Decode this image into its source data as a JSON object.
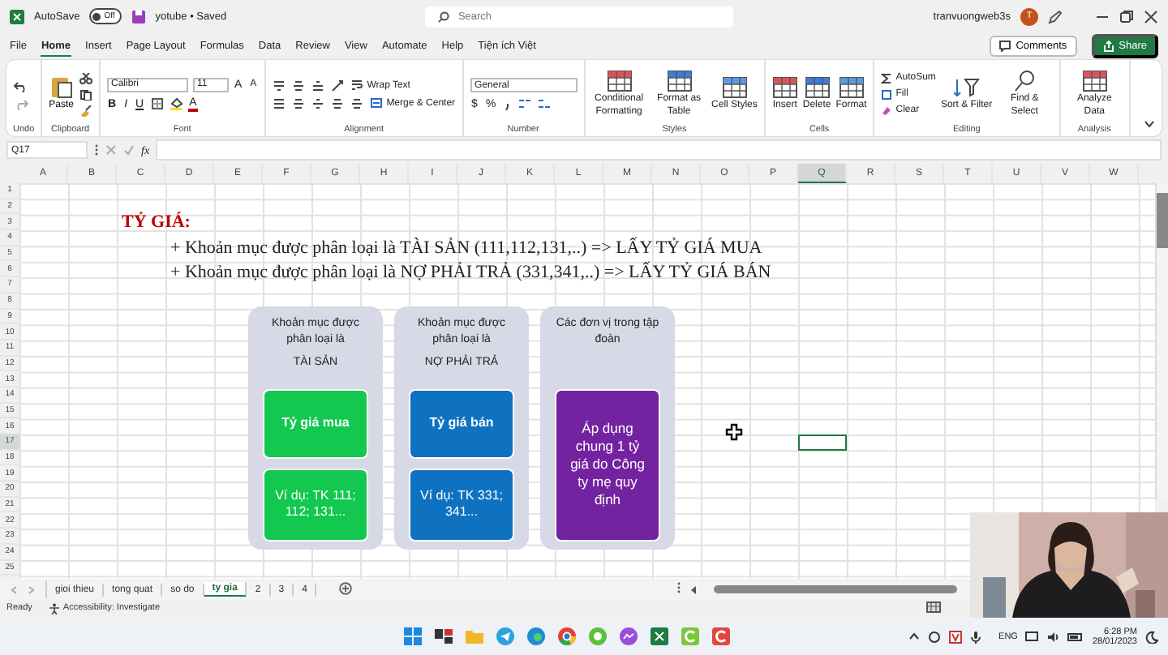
{
  "title_bar": {
    "autosave_label": "AutoSave",
    "autosave_toggle": {
      "label": "Off",
      "on": false
    },
    "file_name": "yotube • Saved",
    "search": {
      "placeholder": "Search"
    },
    "user_name": "tranvuongweb3s",
    "avatar_initial": "T"
  },
  "ribbon_tabs": [
    {
      "label": "File",
      "selected": false
    },
    {
      "label": "Home",
      "selected": true
    },
    {
      "label": "Insert",
      "selected": false
    },
    {
      "label": "Page Layout",
      "selected": false
    },
    {
      "label": "Formulas",
      "selected": false
    },
    {
      "label": "Data",
      "selected": false
    },
    {
      "label": "Review",
      "selected": false
    },
    {
      "label": "View",
      "selected": false
    },
    {
      "label": "Automate",
      "selected": false
    },
    {
      "label": "Help",
      "selected": false
    },
    {
      "label": "Tiện ích Việt",
      "selected": false
    }
  ],
  "comments_button": "Comments",
  "share_button": "Share",
  "ribbon_groups": [
    {
      "kind": "undo",
      "label": "Undo"
    },
    {
      "kind": "clipboard",
      "label": "Clipboard",
      "paste": "Paste"
    },
    {
      "kind": "font",
      "label": "Font",
      "font_name": "Calibri",
      "font_size": "11",
      "grow": "A",
      "shrink": "A",
      "bold": "B",
      "italic": "I",
      "underline": "U",
      "font_color": "A"
    },
    {
      "kind": "alignment",
      "label": "Alignment",
      "wrap_text": "Wrap Text",
      "merge": "Merge & Center"
    },
    {
      "kind": "number",
      "label": "Number",
      "format": "General",
      "currency": "$",
      "percent": "%"
    },
    {
      "kind": "large_buttons",
      "label": "Styles",
      "buttons": [
        "Conditional Formatting",
        "Format as Table",
        "Cell Styles"
      ]
    },
    {
      "kind": "large_buttons",
      "label": "Cells",
      "buttons": [
        "Insert",
        "Delete",
        "Format"
      ]
    },
    {
      "kind": "editing",
      "label": "Editing",
      "autosum": "AutoSum",
      "fill": "Fill",
      "clear": "Clear",
      "sort": "Sort & Filter",
      "find": "Find & Select"
    },
    {
      "kind": "large_buttons",
      "label": "Analysis",
      "buttons": [
        "Analyze Data"
      ]
    }
  ],
  "formula_bar": {
    "name_box": "Q17",
    "fx": "fx"
  },
  "columns": [
    {
      "label": "A",
      "selected": false
    },
    {
      "label": "B",
      "selected": false
    },
    {
      "label": "C",
      "selected": false
    },
    {
      "label": "D",
      "selected": false
    },
    {
      "label": "E",
      "selected": false
    },
    {
      "label": "F",
      "selected": false
    },
    {
      "label": "G",
      "selected": false
    },
    {
      "label": "H",
      "selected": false
    },
    {
      "label": "I",
      "selected": false
    },
    {
      "label": "J",
      "selected": false
    },
    {
      "label": "K",
      "selected": false
    },
    {
      "label": "L",
      "selected": false
    },
    {
      "label": "M",
      "selected": false
    },
    {
      "label": "N",
      "selected": false
    },
    {
      "label": "O",
      "selected": false
    },
    {
      "label": "P",
      "selected": false
    },
    {
      "label": "Q",
      "selected": true
    },
    {
      "label": "R",
      "selected": false
    },
    {
      "label": "S",
      "selected": false
    },
    {
      "label": "T",
      "selected": false
    },
    {
      "label": "U",
      "selected": false
    },
    {
      "label": "V",
      "selected": false
    },
    {
      "label": "W",
      "selected": false
    }
  ],
  "rows": [
    {
      "label": "1",
      "selected": false
    },
    {
      "label": "2",
      "selected": false
    },
    {
      "label": "3",
      "selected": false
    },
    {
      "label": "4",
      "selected": false
    },
    {
      "label": "5",
      "selected": false
    },
    {
      "label": "6",
      "selected": false
    },
    {
      "label": "7",
      "selected": false
    },
    {
      "label": "8",
      "selected": false
    },
    {
      "label": "9",
      "selected": false
    },
    {
      "label": "10",
      "selected": false
    },
    {
      "label": "11",
      "selected": false
    },
    {
      "label": "12",
      "selected": false
    },
    {
      "label": "13",
      "selected": false
    },
    {
      "label": "14",
      "selected": false
    },
    {
      "label": "15",
      "selected": false
    },
    {
      "label": "16",
      "selected": false
    },
    {
      "label": "17",
      "selected": true
    },
    {
      "label": "18",
      "selected": false
    },
    {
      "label": "19",
      "selected": false
    },
    {
      "label": "20",
      "selected": false
    },
    {
      "label": "21",
      "selected": false
    },
    {
      "label": "22",
      "selected": false
    },
    {
      "label": "23",
      "selected": false
    },
    {
      "label": "24",
      "selected": false
    },
    {
      "label": "25",
      "selected": false
    }
  ],
  "sheet_content": {
    "heading": "TỶ GIÁ:",
    "lines": [
      "+ Khoản mục được phân loại là TÀI SẢN (111,112,131,..) => LẤY TỶ GIÁ MUA",
      "+ Khoản mục được phân loại là NỢ PHẢI TRẢ (331,341,..) => LẤY TỶ GIÁ BÁN"
    ],
    "cards": [
      {
        "title": "Khoản mục được phân loại là",
        "subtitle": "TÀI SẢN",
        "boxes": [
          {
            "kind": "label",
            "text": "Tỷ giá mua",
            "color": "#12c84e"
          },
          {
            "kind": "note",
            "text": "Ví dụ: TK 111; 112; 131...",
            "color": "#12c84e"
          }
        ]
      },
      {
        "title": "Khoản mục được phân loại là",
        "subtitle": "NỢ PHẢI TRẢ",
        "boxes": [
          {
            "kind": "label",
            "text": "Tỷ giá bán",
            "color": "#0f72c0"
          },
          {
            "kind": "note",
            "text": "Ví dụ: TK 331; 341...",
            "color": "#0f72c0"
          }
        ]
      },
      {
        "title": "Các đơn vị trong tập đoàn",
        "boxes": [
          {
            "kind": "tall",
            "text": "Áp dụng chung 1 tỷ giá do Công ty mẹ quy định",
            "color": "#7322a0"
          }
        ]
      }
    ]
  },
  "sheet_tabs": [
    {
      "label": "gioi thieu",
      "selected": false
    },
    {
      "label": "tong quat",
      "selected": false
    },
    {
      "label": "so do",
      "selected": false
    },
    {
      "label": "ty gia",
      "selected": true
    },
    {
      "label": "2",
      "selected": false
    },
    {
      "label": "3",
      "selected": false
    },
    {
      "label": "4",
      "selected": false
    }
  ],
  "status_bar": {
    "ready": "Ready",
    "accessibility": "Accessibility: Investigate"
  },
  "taskbar": {
    "language": "ENG",
    "time": "6:28 PM",
    "date": "28/01/2023"
  }
}
